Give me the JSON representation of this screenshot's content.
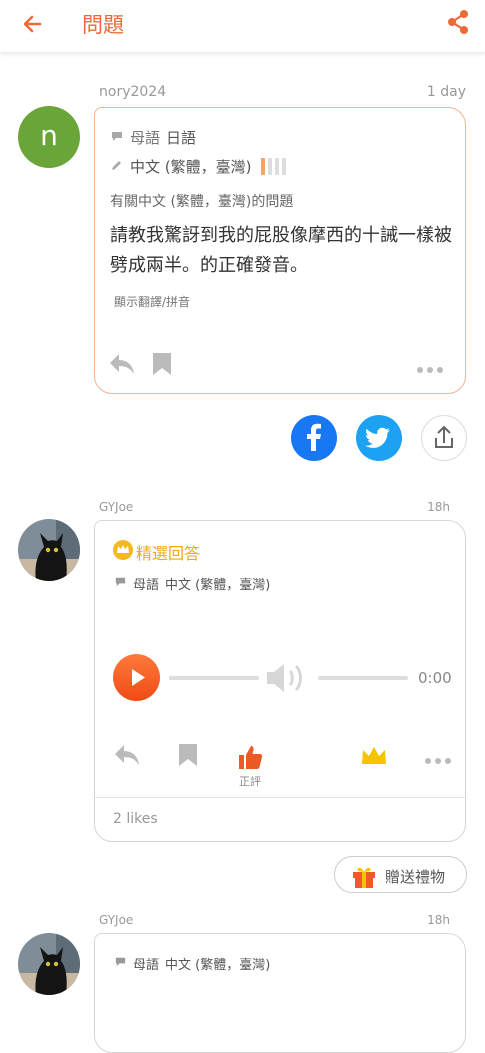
{
  "header": {
    "title": "問題"
  },
  "question": {
    "username": "nory2024",
    "time": "1 day",
    "avatar_letter": "n",
    "avatar_color": "#6aa539",
    "native_label": "母語",
    "native_lang": "日語",
    "study_lang": "中文 (繁體，臺灣)",
    "about": "有關中文 (繁體，臺灣)的問題",
    "text": "請教我驚訝到我的屁股像摩西的十誡一樣被劈成兩半。的正確發音。",
    "show_translation": "顯示翻譯/拼音"
  },
  "answer1": {
    "username": "GYJoe",
    "time": "18h",
    "best_label": "精選回答",
    "native_label": "母語",
    "native_lang": "中文 (繁體，臺灣)",
    "audio_time": "0:00",
    "good_label": "正評",
    "likes": "2 likes"
  },
  "gift": {
    "label": "贈送禮物"
  },
  "answer2": {
    "username": "GYJoe",
    "time": "18h",
    "native_label": "母語",
    "native_lang": "中文 (繁體，臺灣)"
  },
  "colors": {
    "accent": "#ec6a3a",
    "facebook": "#1877f2",
    "twitter": "#1da1f2",
    "best": "#f0a818"
  }
}
